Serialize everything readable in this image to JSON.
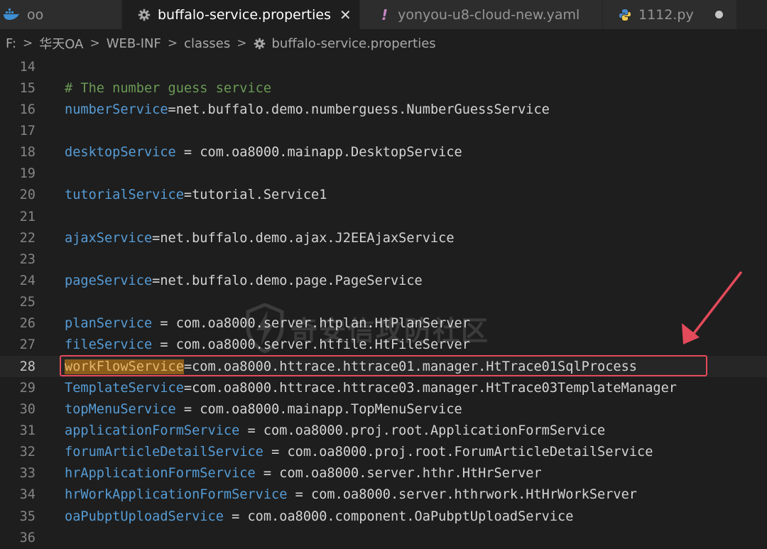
{
  "tabs": [
    {
      "label": "oo",
      "icon": "docker-whale-icon",
      "state": "inactive"
    },
    {
      "label": "buffalo-service.properties",
      "icon": "gear-icon",
      "state": "active",
      "close": "✕"
    },
    {
      "label": "yonyou-u8-cloud-new.yaml",
      "icon": "exclamation-icon",
      "state": "modified"
    },
    {
      "label": "1112.py",
      "icon": "python-icon",
      "state": "modified"
    }
  ],
  "breadcrumb": [
    {
      "label": "F:"
    },
    {
      "label": "华天OA"
    },
    {
      "label": "WEB-INF"
    },
    {
      "label": "classes"
    },
    {
      "label": "buffalo-service.properties",
      "icon": "gear-icon"
    }
  ],
  "editor": {
    "current_line": 28,
    "lines": [
      {
        "n": "14",
        "segments": []
      },
      {
        "n": "15",
        "segments": [
          {
            "t": "# The number guess service",
            "c": "cmt"
          }
        ]
      },
      {
        "n": "16",
        "segments": [
          {
            "t": "numberService",
            "c": "key"
          },
          {
            "t": "=net.buffalo.demo.numberguess.NumberGuessService",
            "c": "val"
          }
        ]
      },
      {
        "n": "17",
        "segments": []
      },
      {
        "n": "18",
        "segments": [
          {
            "t": "desktopService",
            "c": "key"
          },
          {
            "t": " = com.oa8000.mainapp.DesktopService",
            "c": "val"
          }
        ]
      },
      {
        "n": "19",
        "segments": []
      },
      {
        "n": "20",
        "segments": [
          {
            "t": "tutorialService",
            "c": "key"
          },
          {
            "t": "=tutorial.Service1",
            "c": "val"
          }
        ]
      },
      {
        "n": "21",
        "segments": []
      },
      {
        "n": "22",
        "segments": [
          {
            "t": "ajaxService",
            "c": "key"
          },
          {
            "t": "=net.buffalo.demo.ajax.J2EEAjaxService",
            "c": "val"
          }
        ]
      },
      {
        "n": "23",
        "segments": []
      },
      {
        "n": "24",
        "segments": [
          {
            "t": "pageService",
            "c": "key"
          },
          {
            "t": "=net.buffalo.demo.page.PageService",
            "c": "val"
          }
        ]
      },
      {
        "n": "25",
        "segments": []
      },
      {
        "n": "26",
        "segments": [
          {
            "t": "planService",
            "c": "key"
          },
          {
            "t": " = com.oa8000.server.htplan.HtPlanServer",
            "c": "val"
          }
        ]
      },
      {
        "n": "27",
        "segments": [
          {
            "t": "fileService",
            "c": "key"
          },
          {
            "t": " = com.oa8000.server.htfile.HtFileServer",
            "c": "val"
          }
        ]
      },
      {
        "n": "28",
        "segments": [
          {
            "t": "workFlowService",
            "c": "key hl"
          },
          {
            "t": "=com.oa8000.httrace.httrace01.manager.HtTrace01SqlProcess",
            "c": "val"
          }
        ]
      },
      {
        "n": "29",
        "segments": [
          {
            "t": "TemplateService",
            "c": "key"
          },
          {
            "t": "=com.oa8000.httrace.httrace03.manager.HtTrace03TemplateManager",
            "c": "val"
          }
        ]
      },
      {
        "n": "30",
        "segments": [
          {
            "t": "topMenuService",
            "c": "key"
          },
          {
            "t": " = com.oa8000.mainapp.TopMenuService",
            "c": "val"
          }
        ]
      },
      {
        "n": "31",
        "segments": [
          {
            "t": "applicationFormService",
            "c": "key"
          },
          {
            "t": " = com.oa8000.proj.root.ApplicationFormService",
            "c": "val"
          }
        ]
      },
      {
        "n": "32",
        "segments": [
          {
            "t": "forumArticleDetailService",
            "c": "key"
          },
          {
            "t": " = com.oa8000.proj.root.ForumArticleDetailService",
            "c": "val"
          }
        ]
      },
      {
        "n": "33",
        "segments": [
          {
            "t": "hrApplicationFormService",
            "c": "key"
          },
          {
            "t": " = com.oa8000.server.hthr.HtHrServer",
            "c": "val"
          }
        ]
      },
      {
        "n": "34",
        "segments": [
          {
            "t": "hrWorkApplicationFormService",
            "c": "key"
          },
          {
            "t": " = com.oa8000.server.hthrwork.HtHrWorkServer",
            "c": "val"
          }
        ]
      },
      {
        "n": "35",
        "segments": [
          {
            "t": "oaPubptUploadService",
            "c": "key"
          },
          {
            "t": " = com.oa8000.component.OaPubptUploadService",
            "c": "val"
          }
        ]
      },
      {
        "n": "36",
        "segments": []
      }
    ]
  },
  "watermark": {
    "text": "奇安信攻防社区",
    "icon": "lightning-shield-icon"
  },
  "annotation": {
    "box_color": "#e34a5a",
    "arrow_color": "#e34a5a"
  },
  "colors": {
    "editor_bg": "#1e1e1e",
    "tabbar_bg": "#252526",
    "key": "#569cd6",
    "value": "#d4d4d4",
    "comment": "#6a9955",
    "line_number": "#858585"
  }
}
